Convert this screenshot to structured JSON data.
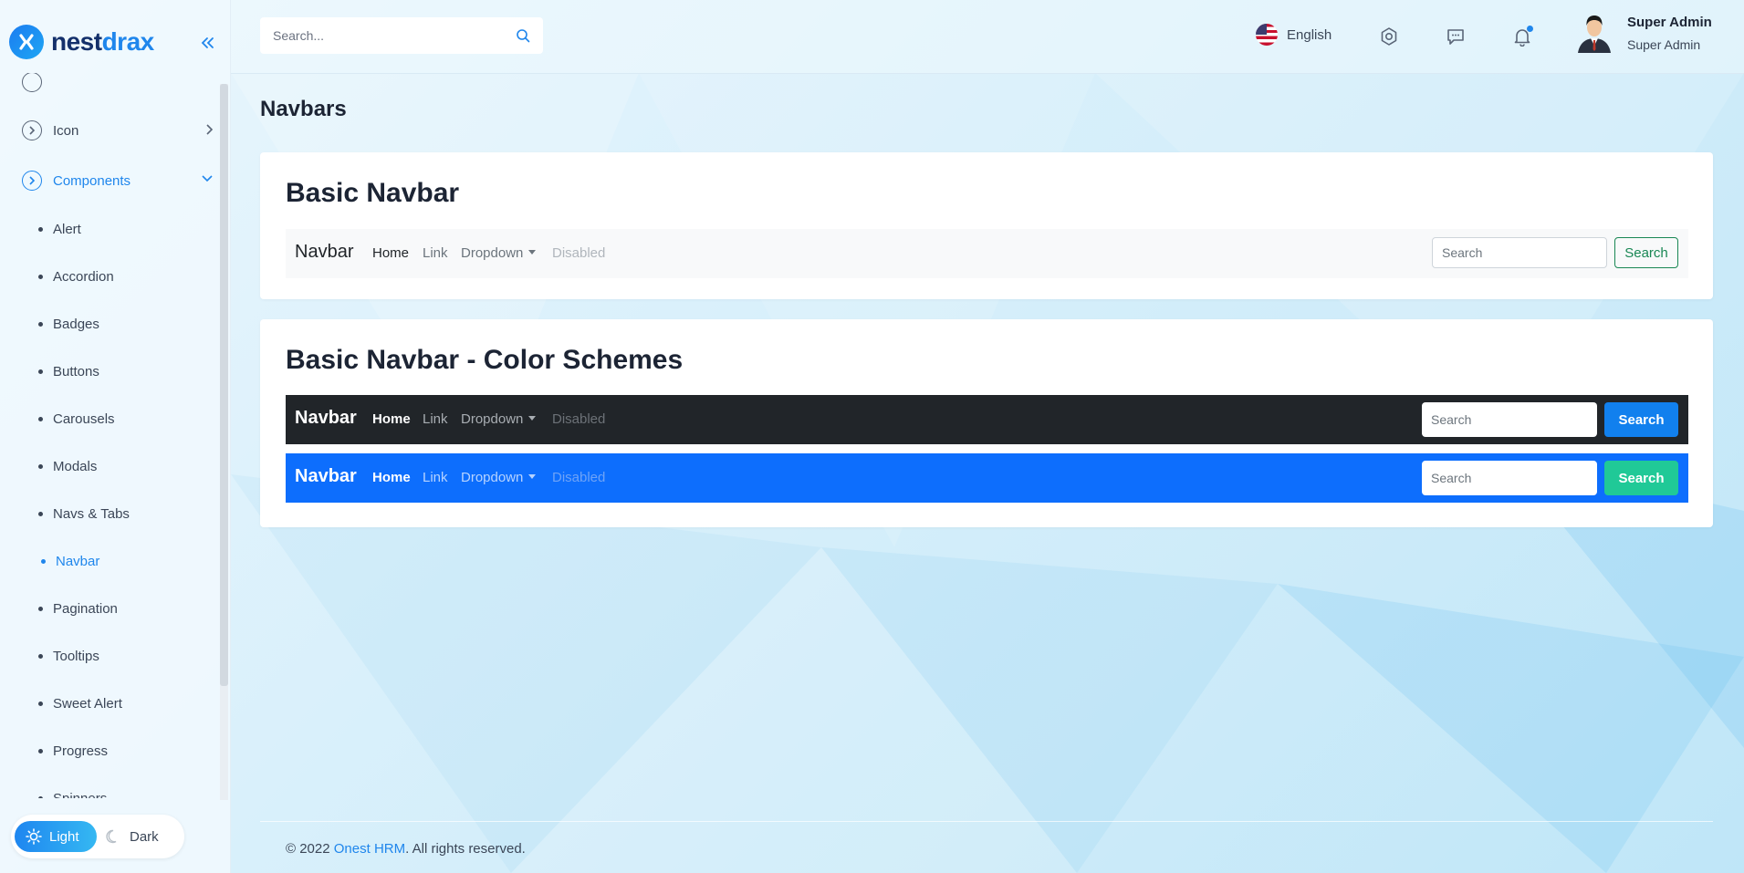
{
  "app": {
    "brand_part1": "nest",
    "brand_part2": "drax"
  },
  "sidebar": {
    "items": [
      {
        "label": "Icon"
      },
      {
        "label": "Components"
      }
    ],
    "components_sub": [
      {
        "label": "Alert"
      },
      {
        "label": "Accordion"
      },
      {
        "label": "Badges"
      },
      {
        "label": "Buttons"
      },
      {
        "label": "Carousels"
      },
      {
        "label": "Modals"
      },
      {
        "label": "Navs & Tabs"
      },
      {
        "label": "Navbar"
      },
      {
        "label": "Pagination"
      },
      {
        "label": "Tooltips"
      },
      {
        "label": "Sweet Alert"
      },
      {
        "label": "Progress"
      },
      {
        "label": "Spinners"
      }
    ],
    "active_sub": "Navbar",
    "theme": {
      "light": "Light",
      "dark": "Dark"
    }
  },
  "header": {
    "search_placeholder": "Search...",
    "language": "English",
    "user_name": "Super Admin",
    "user_role": "Super Admin",
    "icons": [
      "settings-icon",
      "chat-icon",
      "bell-icon"
    ]
  },
  "page": {
    "title": "Navbars"
  },
  "basic_navbar": {
    "title": "Basic Navbar",
    "brand": "Navbar",
    "links": {
      "home": "Home",
      "link": "Link",
      "dropdown": "Dropdown",
      "disabled": "Disabled"
    },
    "search_placeholder": "Search",
    "search_button": "Search"
  },
  "color_schemes": {
    "title": "Basic Navbar - Color Schemes",
    "dark": {
      "brand": "Navbar",
      "links": {
        "home": "Home",
        "link": "Link",
        "dropdown": "Dropdown",
        "disabled": "Disabled"
      },
      "search_placeholder": "Search",
      "search_button": "Search",
      "bg_color": "#212529",
      "button_color": "#1180ee"
    },
    "primary": {
      "brand": "Navbar",
      "links": {
        "home": "Home",
        "link": "Link",
        "dropdown": "Dropdown",
        "disabled": "Disabled"
      },
      "search_placeholder": "Search",
      "search_button": "Search",
      "bg_color": "#0d6efd",
      "button_color": "#20c997"
    }
  },
  "footer": {
    "prefix": "© 2022 ",
    "link": "Onest HRM",
    "suffix": ". All rights reserved."
  },
  "colors": {
    "accent": "#1f86ec",
    "success_outline": "#198754"
  }
}
